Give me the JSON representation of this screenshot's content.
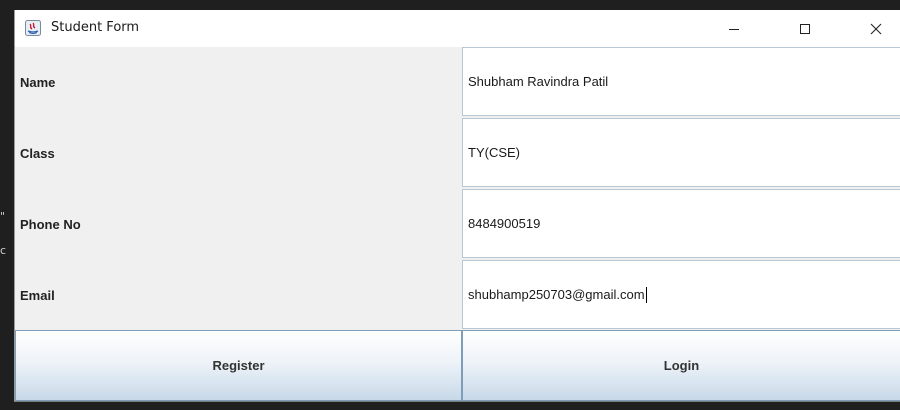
{
  "window": {
    "title": "Student Form",
    "controls": {
      "minimize": "minimize-icon",
      "maximize": "maximize-icon",
      "close": "close-icon"
    }
  },
  "form": {
    "fields": [
      {
        "label": "Name",
        "value": "Shubham Ravindra Patil"
      },
      {
        "label": "Class",
        "value": "TY(CSE)"
      },
      {
        "label": "Phone No",
        "value": "8484900519"
      },
      {
        "label": "Email",
        "value": "shubhamp250703@gmail.com"
      }
    ]
  },
  "buttons": {
    "register": "Register",
    "login": "Login"
  },
  "backdrop": {
    "fragment_1": "\"",
    "fragment_2": "c"
  },
  "colors": {
    "window_bg": "#f0f0f0",
    "field_bg": "#ffffff",
    "field_border": "#b9c6d3",
    "button_border": "#7e9db8"
  }
}
